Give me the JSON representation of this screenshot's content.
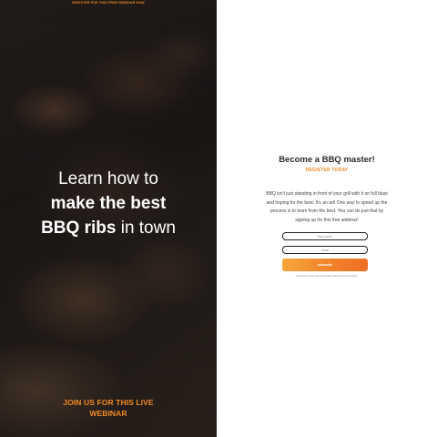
{
  "left_panel": {
    "top_bar": "REGISTER FOR THIS FREE WEBINAR NOW",
    "headline": {
      "line1": "Learn how to",
      "line2": "make the best",
      "line3_bold": "BBQ ribs",
      "line3_rest": " in town"
    },
    "cta_line1": "JOIN US FOR THIS LIVE",
    "cta_line2": "WEBINAR"
  },
  "form_panel": {
    "title": "Become a BBQ master!",
    "subtitle": "REGISTER TODAY",
    "body": "BBQ isn't just standing in front of your grill with it on full blast and hoping for the best. It's an art! One way to speed up the process is to learn from the best. You can do just that by signing up for this free webinar!",
    "name_placeholder": "first name",
    "email_placeholder": "email",
    "subscribe_label": "subscribe",
    "disclaimer": "We'll never share your information without your permission"
  },
  "colors": {
    "accent": "#f08a24",
    "button_start": "#f7a53a",
    "button_end": "#ee6f25",
    "dark_panel": "#1b1816"
  }
}
